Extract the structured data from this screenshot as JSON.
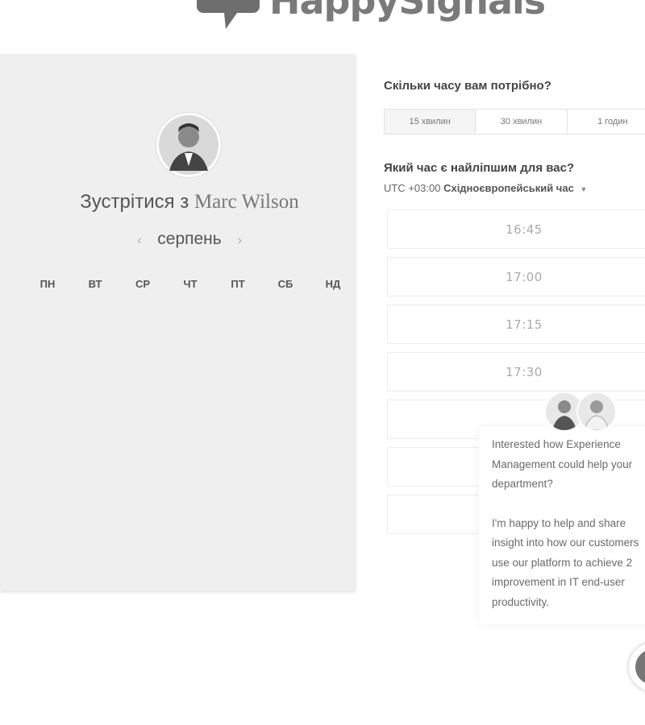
{
  "logo": {
    "text": "HappySignals"
  },
  "booking": {
    "title_prefix": "Зустрітися з",
    "host_name": "Marc Wilson",
    "month": "серпень",
    "weekdays": [
      "ПН",
      "ВТ",
      "СР",
      "ЧТ",
      "ПТ",
      "СБ",
      "НД"
    ]
  },
  "duration": {
    "question": "Скільки часу вам потрібно?",
    "options": [
      "15 хвилин",
      "30 хвилин",
      "1 годин"
    ],
    "selected": "15 хвилин"
  },
  "time": {
    "question": "Який час є найліпшим для вас?",
    "timezone_offset": "UTC +03:00",
    "timezone_name": "Східноєвропейський час",
    "slots": [
      "16:45",
      "17:00",
      "17:15",
      "17:30",
      "",
      "",
      ""
    ]
  },
  "chat": {
    "paragraph1": "Interested how Experience Management could help your department?",
    "paragraph2": "I'm happy to help and share insight into how our customers use our platform to achieve 2 improvement in IT end-user productivity."
  },
  "colors": {
    "panel_bg": "#efefef",
    "logo": "#7a7a7a"
  },
  "icons": [
    "chat-bubble-logo-icon",
    "chevron-left-icon",
    "chevron-right-icon",
    "caret-down-icon",
    "chat-launcher-icon"
  ]
}
